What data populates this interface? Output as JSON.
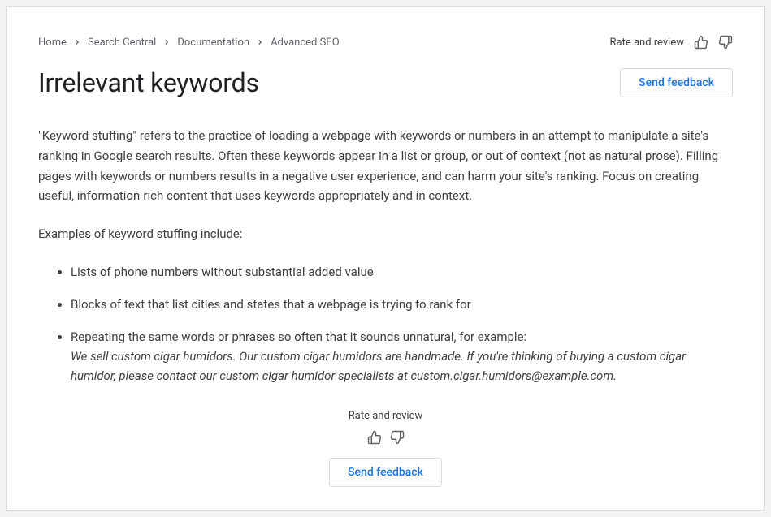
{
  "breadcrumb": {
    "items": [
      "Home",
      "Search Central",
      "Documentation",
      "Advanced SEO"
    ]
  },
  "rate_review": {
    "label": "Rate and review"
  },
  "title": "Irrelevant keywords",
  "feedback_button": "Send feedback",
  "content": {
    "intro": "\"Keyword stuffing\" refers to the practice of loading a webpage with keywords or numbers in an attempt to manipulate a site's ranking in Google search results. Often these keywords appear in a list or group, or out of context (not as natural prose). Filling pages with keywords or numbers results in a negative user experience, and can harm your site's ranking. Focus on creating useful, information-rich content that uses keywords appropriately and in context.",
    "examples_label": "Examples of keyword stuffing include:",
    "examples": [
      {
        "text": "Lists of phone numbers without substantial added value"
      },
      {
        "text": "Blocks of text that list cities and states that a webpage is trying to rank for"
      },
      {
        "text": "Repeating the same words or phrases so often that it sounds unnatural, for example:",
        "italic": "We sell custom cigar humidors. Our custom cigar humidors are handmade. If you're thinking of buying a custom cigar humidor, please contact our custom cigar humidor specialists at custom.cigar.humidors@example.com."
      }
    ]
  }
}
